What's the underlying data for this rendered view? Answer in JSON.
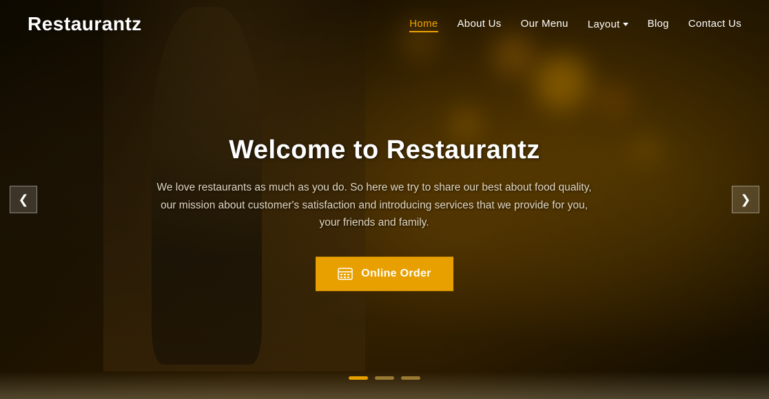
{
  "brand": {
    "logo": "Restaurantz"
  },
  "navbar": {
    "links": [
      {
        "label": "Home",
        "active": true,
        "hasDropdown": false
      },
      {
        "label": "About Us",
        "active": false,
        "hasDropdown": false
      },
      {
        "label": "Our Menu",
        "active": false,
        "hasDropdown": false
      },
      {
        "label": "Layout",
        "active": false,
        "hasDropdown": true
      },
      {
        "label": "Blog",
        "active": false,
        "hasDropdown": false
      },
      {
        "label": "Contact Us",
        "active": false,
        "hasDropdown": false
      }
    ]
  },
  "hero": {
    "title": "Welcome to Restaurantz",
    "subtitle": "We love restaurants as much as you do. So here we try to share our best about food quality, our mission about customer's satisfaction and introducing services that we provide for you, your friends and family.",
    "cta_label": "Online Order"
  },
  "slider": {
    "prev_label": "❮",
    "next_label": "❯",
    "dots": [
      "active",
      "inactive",
      "inactive"
    ]
  },
  "colors": {
    "accent": "#e8a000",
    "bg_dark": "#1a1000",
    "text_light": "#ffffff",
    "text_muted": "#e0d5c0"
  }
}
